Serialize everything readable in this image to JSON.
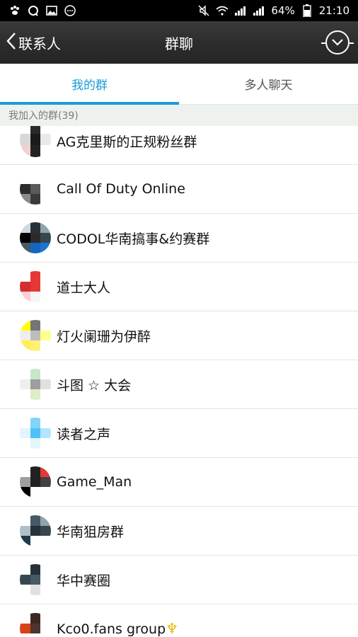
{
  "status_bar": {
    "battery": "64%",
    "time": "21:10",
    "icons_left": [
      "paw-icon",
      "message-icon",
      "image-icon",
      "more-circle-icon"
    ],
    "icons_right": [
      "mute-icon",
      "wifi-icon",
      "signal-icon",
      "signal-icon-2",
      "battery-icon"
    ]
  },
  "nav": {
    "back_label": "联系人",
    "title": "群聊",
    "more_icon": "chevron-down-circle-icon"
  },
  "tabs": [
    {
      "label": "我的群",
      "active": true
    },
    {
      "label": "多人聊天",
      "active": false
    }
  ],
  "section": {
    "header": "我加入的群(39)"
  },
  "groups": [
    {
      "name": "AG克里斯的正规粉丝群",
      "avatar_colors": [
        "#ffffff",
        "#2a2a2a",
        "#ffffff",
        "#d8d8d8",
        "#1b1b1b",
        "#e9e9e9",
        "#f0d0d0",
        "#222222",
        "#ffffff"
      ]
    },
    {
      "name": "Call Of Duty Online",
      "avatar_colors": [
        "#ffffff",
        "#ffffff",
        "#ffffff",
        "#2c2c2c",
        "#5a5a5a",
        "#ffffff",
        "#8a8a8a",
        "#3a3a3a",
        "#ffffff"
      ]
    },
    {
      "name": "CODOL华南搞事&约赛群",
      "avatar_colors": [
        "#cfd8dc",
        "#263238",
        "#90a4ae",
        "#000000",
        "#2b2b2b",
        "#37474f",
        "#455a64",
        "#1565c0",
        "#1976d2"
      ]
    },
    {
      "name": "道士大人",
      "avatar_colors": [
        "#ffffff",
        "#e53935",
        "#ffffff",
        "#d32f2f",
        "#e53935",
        "#ffffff",
        "#ffcdd2",
        "#f5f5f5",
        "#ffffff"
      ]
    },
    {
      "name": "灯火阑珊为伊醉",
      "avatar_colors": [
        "#ffff00",
        "#757575",
        "#ffffff",
        "#eeeeee",
        "#bdbdbd",
        "#ffff8d",
        "#ffee58",
        "#fff176",
        "#ffffff"
      ]
    },
    {
      "name": "斗图 ☆ 大会",
      "avatar_colors": [
        "#ffffff",
        "#c8e6c9",
        "#ffffff",
        "#eeeeee",
        "#9e9e9e",
        "#e0e0e0",
        "#ffffff",
        "#dcedc8",
        "#ffffff"
      ]
    },
    {
      "name": "读者之声",
      "avatar_colors": [
        "#ffffff",
        "#81d4fa",
        "#ffffff",
        "#e1f5fe",
        "#4fc3f7",
        "#b3e5fc",
        "#ffffff",
        "#e0f7fa",
        "#ffffff"
      ]
    },
    {
      "name": "Game_Man",
      "avatar_colors": [
        "#ffffff",
        "#212121",
        "#e53935",
        "#9e9e9e",
        "#212121",
        "#424242",
        "#000000",
        "#ffffff",
        "#ffffff"
      ]
    },
    {
      "name": "华南狙房群",
      "avatar_colors": [
        "#ffffff",
        "#455a64",
        "#90a4ae",
        "#b0bec5",
        "#263238",
        "#37474f",
        "#1e3a4a",
        "#ffffff",
        "#ffffff"
      ]
    },
    {
      "name": "华中赛圈",
      "avatar_colors": [
        "#ffffff",
        "#263238",
        "#ffffff",
        "#37474f",
        "#455a64",
        "#ffffff",
        "#ffffff",
        "#e0e0e0",
        "#ffffff"
      ]
    },
    {
      "name": "Kco0.fans group",
      "suffix": "♆",
      "avatar_colors": [
        "#ffffff",
        "#3e2723",
        "#ffffff",
        "#d84315",
        "#4e342e",
        "#ffffff",
        "#ffffff",
        "#ffffff",
        "#ffffff"
      ]
    }
  ],
  "colors": {
    "accent": "#1a9bd7",
    "nav_bg": "#2b2b2b",
    "section_bg": "#eef2ee"
  }
}
